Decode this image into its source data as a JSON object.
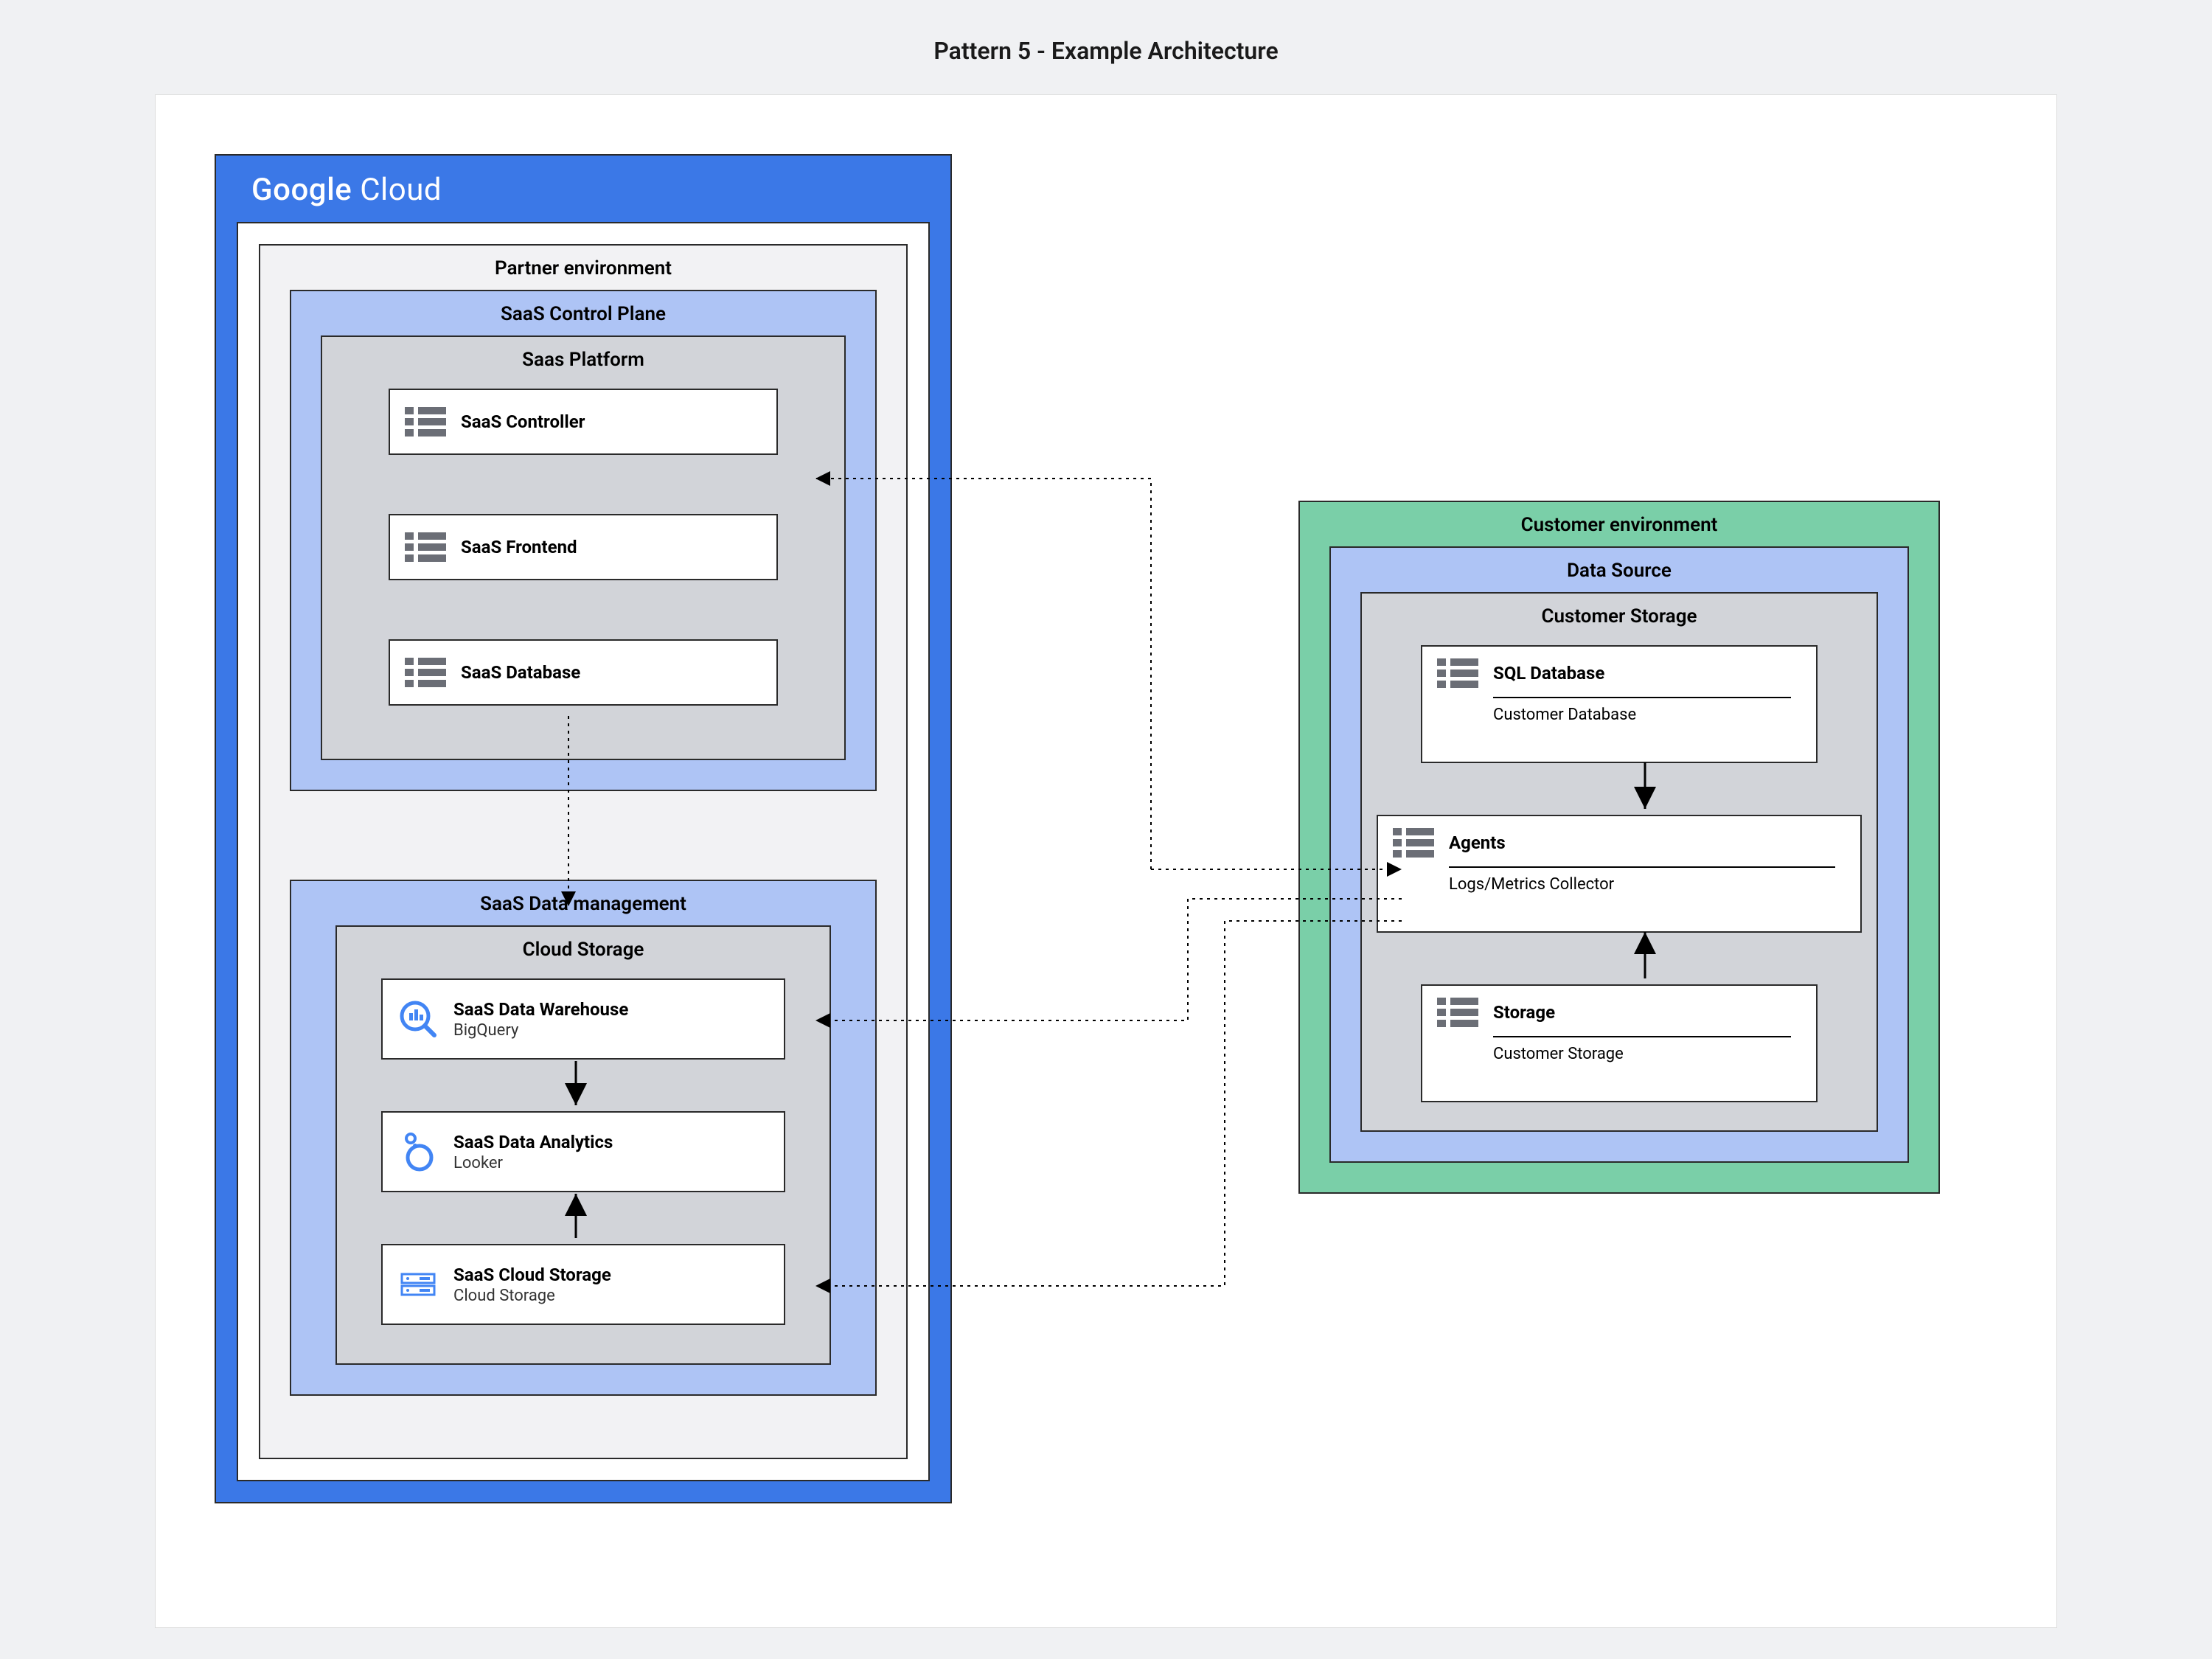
{
  "title": "Pattern 5 - Example Architecture",
  "google_cloud_label": "Google Cloud",
  "partner": {
    "label": "Partner environment",
    "control_plane": {
      "label": "SaaS Control Plane",
      "platform": {
        "label": "Saas Platform",
        "items": [
          {
            "name": "SaaS Controller"
          },
          {
            "name": "SaaS Frontend"
          },
          {
            "name": "SaaS Database"
          }
        ]
      }
    },
    "data_mgmt": {
      "label": "SaaS Data management",
      "cloud_storage": {
        "label": "Cloud Storage",
        "items": [
          {
            "name": "SaaS Data Warehouse",
            "sub": "BigQuery"
          },
          {
            "name": "SaaS Data Analytics",
            "sub": "Looker"
          },
          {
            "name": "SaaS Cloud Storage",
            "sub": "Cloud Storage"
          }
        ]
      }
    }
  },
  "customer": {
    "label": "Customer environment",
    "data_source": {
      "label": "Data Source",
      "storage": {
        "label": "Customer Storage",
        "items": [
          {
            "name": "SQL Database",
            "sub": "Customer Database"
          },
          {
            "name": "Agents",
            "sub": "Logs/Metrics Collector"
          },
          {
            "name": "Storage",
            "sub": "Customer Storage"
          }
        ]
      }
    }
  }
}
